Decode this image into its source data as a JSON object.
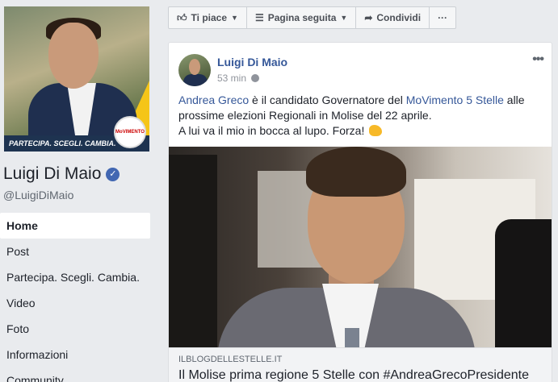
{
  "page": {
    "name": "Luigi Di Maio",
    "handle": "@LuigiDiMaio",
    "banner": "PARTECIPA. SCEGLI. CAMBIA.",
    "logo_text": "MoVIMENTO"
  },
  "nav": [
    {
      "label": "Home",
      "active": true
    },
    {
      "label": "Post"
    },
    {
      "label": "Partecipa. Scegli. Cambia."
    },
    {
      "label": "Video"
    },
    {
      "label": "Foto"
    },
    {
      "label": "Informazioni"
    },
    {
      "label": "Community"
    }
  ],
  "actions": {
    "like": "Ti piace",
    "following": "Pagina seguita",
    "share": "Condividi",
    "more": "···"
  },
  "post": {
    "author": "Luigi Di Maio",
    "time": "53 min",
    "more": "•••",
    "text": {
      "mention": "Andrea Greco",
      "part1": " è il candidato Governatore del ",
      "movement": "MoVimento 5 Stelle",
      "part2": " alle prossime elezioni Regionali in Molise del 22 aprile.",
      "line2": "A lui va il mio in bocca al lupo. Forza!"
    },
    "link": {
      "domain": "ILBLOGDELLESTELLE.IT",
      "title": "Il Molise prima regione 5 Stelle con #AndreaGrecoPresidente"
    }
  },
  "colors": {
    "link": "#365899",
    "background": "#e9ebee",
    "verified": "#4267b2"
  }
}
